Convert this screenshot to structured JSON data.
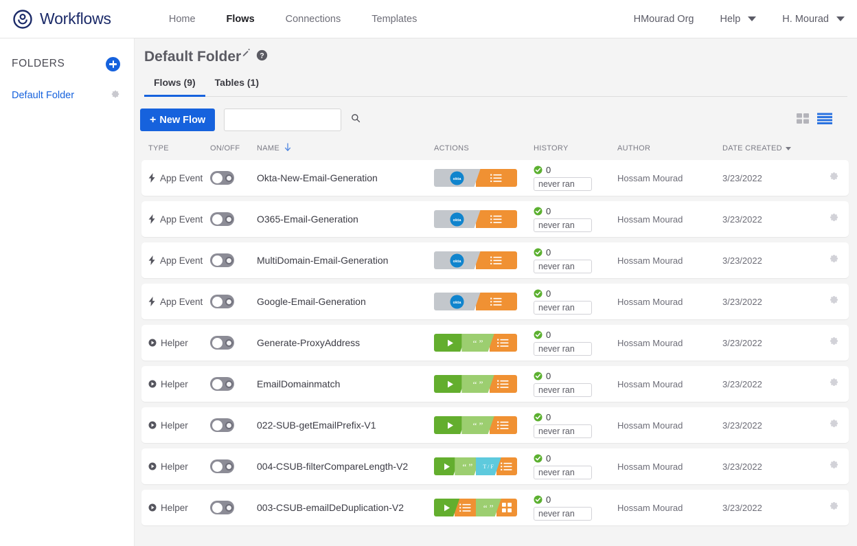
{
  "topnav": {
    "brand": "Workflows",
    "brand_logo_icon": "okta-logo-icon",
    "links": [
      {
        "label": "Home",
        "active": false
      },
      {
        "label": "Flows",
        "active": true
      },
      {
        "label": "Connections",
        "active": false
      },
      {
        "label": "Templates",
        "active": false
      }
    ],
    "org": "HMourad Org",
    "help": "Help",
    "user": "H. Mourad"
  },
  "sidebar": {
    "title": "FOLDERS",
    "add_button_icon": "plus-circle-icon",
    "items": [
      {
        "label": "Default Folder",
        "gear_icon": "gear-icon"
      }
    ]
  },
  "page": {
    "title": "Default Folder",
    "edit_icon": "pencil-icon",
    "help_icon": "question-circle-icon",
    "tabs": [
      {
        "label": "Flows (9)",
        "active": true
      },
      {
        "label": "Tables (1)",
        "active": false
      }
    ]
  },
  "toolbar": {
    "new_flow_label": "New Flow",
    "new_flow_plus": "+",
    "search_value": "",
    "search_placeholder": "",
    "search_icon": "search-icon",
    "grid_view_icon": "grid-view-icon",
    "list_view_icon": "list-view-icon",
    "active_view": "list"
  },
  "table": {
    "columns": [
      {
        "key": "type",
        "label": "TYPE"
      },
      {
        "key": "onoff",
        "label": "ON/OFF"
      },
      {
        "key": "name",
        "label": "NAME",
        "sort": "asc",
        "sort_icon": "arrow-down-icon"
      },
      {
        "key": "actions",
        "label": "ACTIONS"
      },
      {
        "key": "history",
        "label": "HISTORY"
      },
      {
        "key": "author",
        "label": "AUTHOR"
      },
      {
        "key": "date",
        "label": "DATE CREATED",
        "sort": "desc",
        "sort_icon": "triangle-down-icon"
      }
    ],
    "rows": [
      {
        "type": "App Event",
        "type_icon": "lightning-icon",
        "toggle_state": "off",
        "name": "Okta-New-Email-Generation",
        "thumb": [
          "okta-gray",
          "orange-list"
        ],
        "history_count": "0",
        "history_status": "success",
        "last_run": "never ran",
        "author": "Hossam Mourad",
        "date": "3/23/2022",
        "gear_icon": "gear-icon"
      },
      {
        "type": "App Event",
        "type_icon": "lightning-icon",
        "toggle_state": "off",
        "name": "O365-Email-Generation",
        "thumb": [
          "okta-gray",
          "orange-list"
        ],
        "history_count": "0",
        "history_status": "success",
        "last_run": "never ran",
        "author": "Hossam Mourad",
        "date": "3/23/2022",
        "gear_icon": "gear-icon"
      },
      {
        "type": "App Event",
        "type_icon": "lightning-icon",
        "toggle_state": "off",
        "name": "MultiDomain-Email-Generation",
        "thumb": [
          "okta-gray",
          "orange-list"
        ],
        "history_count": "0",
        "history_status": "success",
        "last_run": "never ran",
        "author": "Hossam Mourad",
        "date": "3/23/2022",
        "gear_icon": "gear-icon"
      },
      {
        "type": "App Event",
        "type_icon": "lightning-icon",
        "toggle_state": "off",
        "name": "Google-Email-Generation",
        "thumb": [
          "okta-gray",
          "orange-list"
        ],
        "history_count": "0",
        "history_status": "success",
        "last_run": "never ran",
        "author": "Hossam Mourad",
        "date": "3/23/2022",
        "gear_icon": "gear-icon"
      },
      {
        "type": "Helper",
        "type_icon": "play-circle-icon",
        "toggle_state": "off",
        "name": "Generate-ProxyAddress",
        "thumb": [
          "green-play",
          "green-quote",
          "orange-list"
        ],
        "history_count": "0",
        "history_status": "success",
        "last_run": "never ran",
        "author": "Hossam Mourad",
        "date": "3/23/2022",
        "gear_icon": "gear-icon"
      },
      {
        "type": "Helper",
        "type_icon": "play-circle-icon",
        "toggle_state": "off",
        "name": "EmailDomainmatch",
        "thumb": [
          "green-play",
          "green-quote",
          "orange-list"
        ],
        "history_count": "0",
        "history_status": "success",
        "last_run": "never ran",
        "author": "Hossam Mourad",
        "date": "3/23/2022",
        "gear_icon": "gear-icon"
      },
      {
        "type": "Helper",
        "type_icon": "play-circle-icon",
        "toggle_state": "off",
        "name": "022-SUB-getEmailPrefix-V1",
        "thumb": [
          "green-play",
          "green-quote",
          "orange-list"
        ],
        "history_count": "0",
        "history_status": "success",
        "last_run": "never ran",
        "author": "Hossam Mourad",
        "date": "3/23/2022",
        "gear_icon": "gear-icon"
      },
      {
        "type": "Helper",
        "type_icon": "play-circle-icon",
        "toggle_state": "off",
        "name": "004-CSUB-filterCompareLength-V2",
        "thumb": [
          "green-play",
          "green-quote",
          "cyan-tf",
          "orange-list"
        ],
        "history_count": "0",
        "history_status": "success",
        "last_run": "never ran",
        "author": "Hossam Mourad",
        "date": "3/23/2022",
        "gear_icon": "gear-icon"
      },
      {
        "type": "Helper",
        "type_icon": "play-circle-icon",
        "toggle_state": "off",
        "name": "003-CSUB-emailDeDuplication-V2",
        "thumb": [
          "green-play",
          "orange-list",
          "green-quote",
          "orange-grid"
        ],
        "history_count": "0",
        "history_status": "success",
        "last_run": "never ran",
        "author": "Hossam Mourad",
        "date": "3/23/2022",
        "gear_icon": "gear-icon"
      }
    ]
  },
  "colors": {
    "brand_navy": "#1b2a68",
    "accent_blue": "#1662dd",
    "success_green": "#5cb030",
    "orange": "#f09133",
    "green_dark": "#63ae2e",
    "green_light": "#9cce70",
    "cyan": "#5ecadd",
    "okta_blue": "#1084cd",
    "page_bg": "#f4f4f4"
  }
}
